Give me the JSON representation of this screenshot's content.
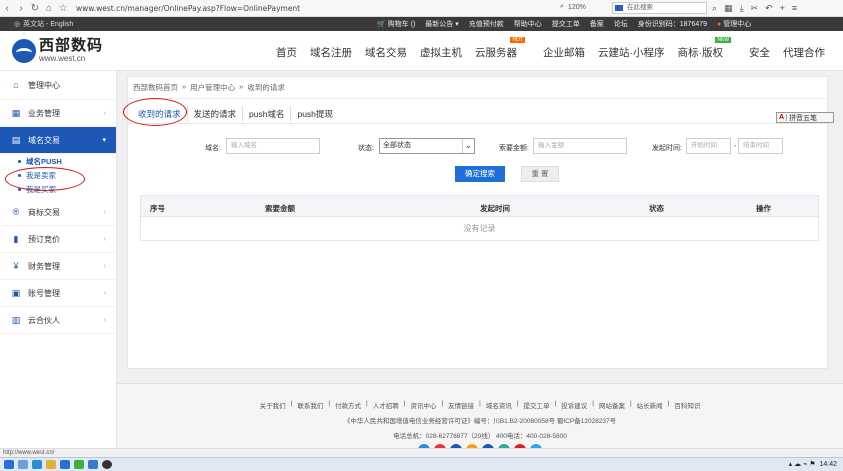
{
  "browser": {
    "url": "www.west.cn/manager/OnlinePay.asp?Flow=OnlinePayment",
    "zoom": "120%",
    "search_placeholder": "在此搜索"
  },
  "site_top": {
    "lang": "英文站 - English",
    "cart": "购物车",
    "cart_count": "()",
    "announce": "最新公告",
    "recharge": "充值预付款",
    "help": "帮助中心",
    "ticket": "提交工单",
    "record": "备案",
    "forum": "论坛",
    "uid_label": "身份识别码：",
    "uid": "1876479",
    "manage": "管理中心"
  },
  "header": {
    "logo_cn": "西部数码",
    "logo_en": "www.west.cn",
    "nav": [
      "首页",
      "域名注册",
      "域名交易",
      "虚拟主机",
      "云服务器",
      "企业邮箱",
      "云建站·小程序",
      "商标·版权",
      "安全",
      "代理合作"
    ],
    "nav_badge_hot": "HOT",
    "nav_badge_new": "NEW"
  },
  "sidebar": {
    "items": [
      {
        "label": "管理中心",
        "icon": "home-icon"
      },
      {
        "label": "业务管理",
        "icon": "grid-icon"
      },
      {
        "label": "域名交易",
        "icon": "card-icon",
        "active": true
      },
      {
        "label": "商标交易",
        "icon": "r-icon"
      },
      {
        "label": "预订竞价",
        "icon": "bar-icon"
      },
      {
        "label": "财务管理",
        "icon": "money-icon"
      },
      {
        "label": "账号管理",
        "icon": "account-icon"
      },
      {
        "label": "云合伙人",
        "icon": "partner-icon"
      }
    ],
    "subitems": [
      "域名PUSH",
      "我是卖家",
      "我是买家"
    ]
  },
  "breadcrumb": [
    "西部数码首页",
    "用户管理中心",
    "收到的请求"
  ],
  "tabs": [
    "收到的请求",
    "发送的请求",
    "push域名",
    "push提现"
  ],
  "form": {
    "domain_label": "域名:",
    "domain_placeholder": "输入域名",
    "status_label": "状态:",
    "status_value": "全部状态",
    "amount_label": "索要金额:",
    "amount_placeholder": "输入金额",
    "time_label": "发起时间:",
    "start_placeholder": "开始时间",
    "end_placeholder": "结束时间",
    "time_sep": "-",
    "search_btn": "确定搜索",
    "reset_btn": "重 置"
  },
  "table": {
    "headers": [
      "序号",
      "索要金额",
      "发起时间",
      "状态",
      "操作"
    ],
    "empty": "没有记录"
  },
  "footer": {
    "links": [
      "关于我们",
      "联系我们",
      "付款方式",
      "人才招聘",
      "资讯中心",
      "友情链接",
      "域名资讯",
      "提交工单",
      "投诉建议",
      "网站备案",
      "站长新闻",
      "百科知识"
    ],
    "license": "《中华人民共和国增值电信业务经营许可证》编号：川B1.B2-20080058号 蜀ICP备12028237号",
    "phone": "电话总机：028-62778877（20线）    400电话：400-028-5800"
  },
  "ime": "拼音五笔",
  "status_url": "http://www.west.cn/",
  "clock": "14:42",
  "colors": {
    "brand": "#1d58b6",
    "search": "#1d71d6",
    "top_strip": "#3a3a3a",
    "annotation": "#d11"
  }
}
